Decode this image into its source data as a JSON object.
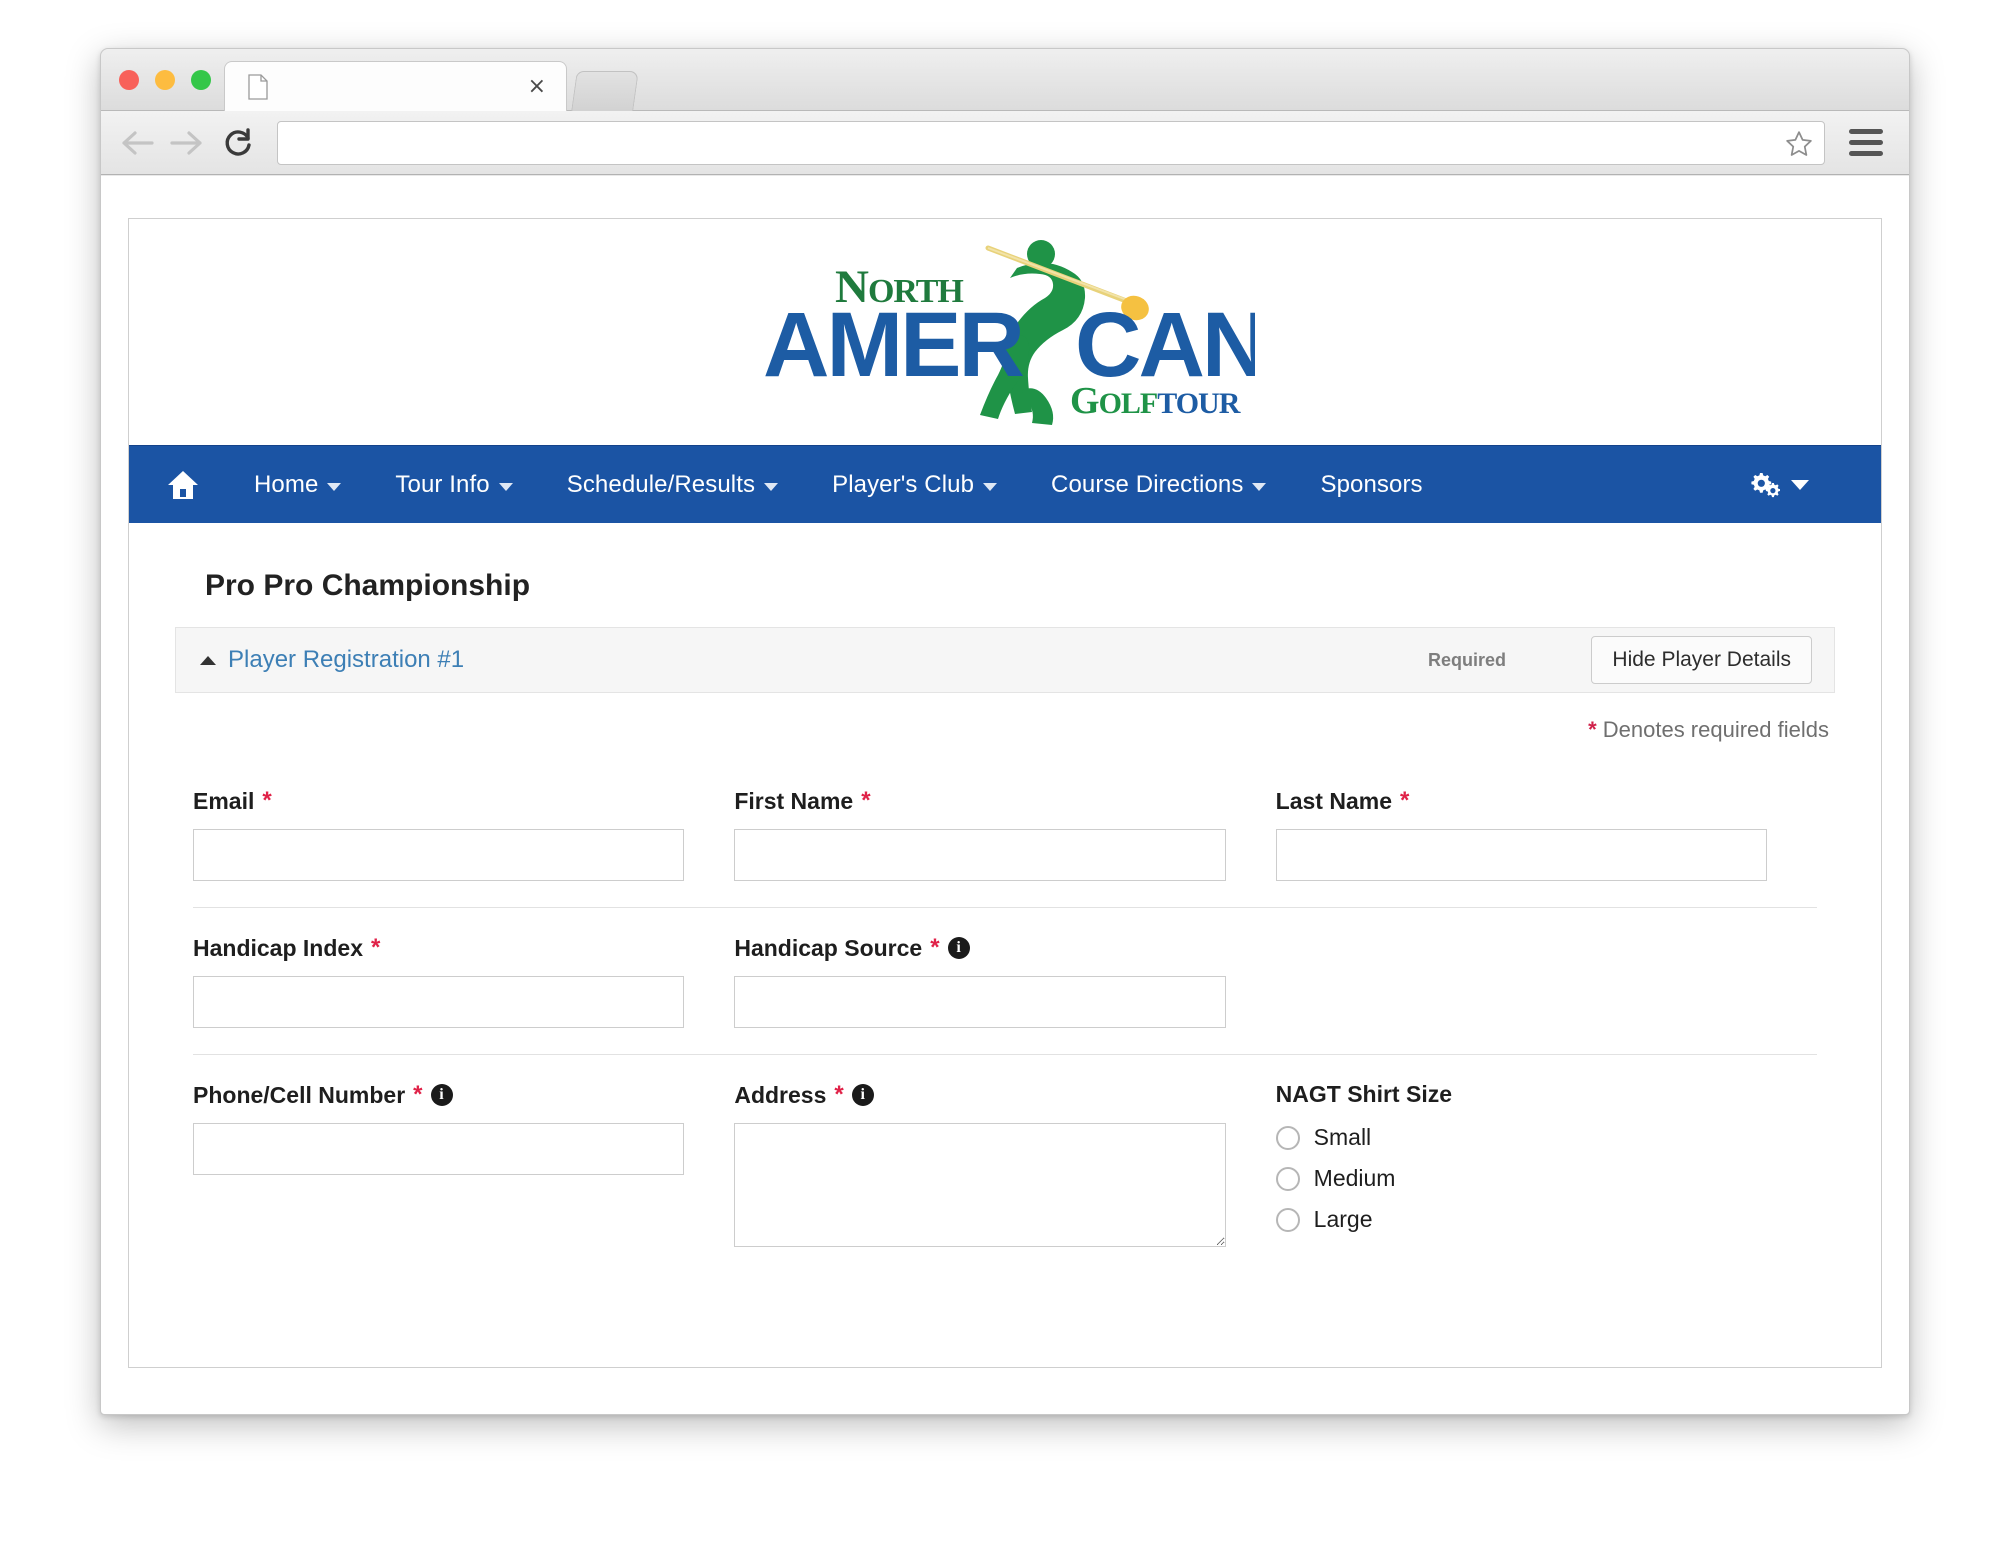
{
  "browser": {
    "tab_title": "",
    "tab_close_glyph": "×",
    "url_value": "",
    "url_placeholder": "",
    "icons": {
      "back": "back-arrow-icon",
      "forward": "forward-arrow-icon",
      "reload": "reload-icon",
      "bookmark": "star-icon",
      "menu": "hamburger-menu-icon",
      "favicon": "page-favicon-icon"
    }
  },
  "site": {
    "logo": {
      "name": "north-american-golf-tour-logo",
      "word_north": "North",
      "word_amer": "AMER",
      "word_can": "CAN",
      "word_golf": "GOLF",
      "word_tour": "TOUR",
      "green": "#1f9347",
      "blue": "#1d5ca4",
      "yellow": "#f5c141"
    },
    "nav": {
      "background": "#1b54a4",
      "home_icon": "home-icon",
      "settings_icon": "gears-icon",
      "items": [
        {
          "label": "Home",
          "caret": true
        },
        {
          "label": "Tour Info",
          "caret": true
        },
        {
          "label": "Schedule/Results",
          "caret": true
        },
        {
          "label": "Player's Club",
          "caret": true
        },
        {
          "label": "Course Directions",
          "caret": true
        },
        {
          "label": "Sponsors",
          "caret": false
        }
      ]
    },
    "page_title": "Pro Pro Championship",
    "registration": {
      "section_title": "Player Registration #1",
      "required_label": "Required",
      "hide_button": "Hide Player Details",
      "denotes_star": "*",
      "denotes_text": " Denotes required fields"
    },
    "form": {
      "fields": {
        "email": {
          "label": "Email",
          "required": true,
          "info": false,
          "value": ""
        },
        "first_name": {
          "label": "First Name",
          "required": true,
          "info": false,
          "value": ""
        },
        "last_name": {
          "label": "Last Name",
          "required": true,
          "info": false,
          "value": ""
        },
        "handicap_index": {
          "label": "Handicap Index",
          "required": true,
          "info": false,
          "value": ""
        },
        "handicap_source": {
          "label": "Handicap Source",
          "required": true,
          "info": true,
          "value": ""
        },
        "phone": {
          "label": "Phone/Cell Number",
          "required": true,
          "info": true,
          "value": ""
        },
        "address": {
          "label": "Address",
          "required": true,
          "info": true,
          "value": ""
        }
      },
      "shirt_size": {
        "label": "NAGT Shirt Size",
        "options": [
          {
            "label": "Small",
            "selected": false
          },
          {
            "label": "Medium",
            "selected": false
          },
          {
            "label": "Large",
            "selected": false
          }
        ]
      },
      "required_star": "*",
      "info_glyph": "i"
    }
  }
}
